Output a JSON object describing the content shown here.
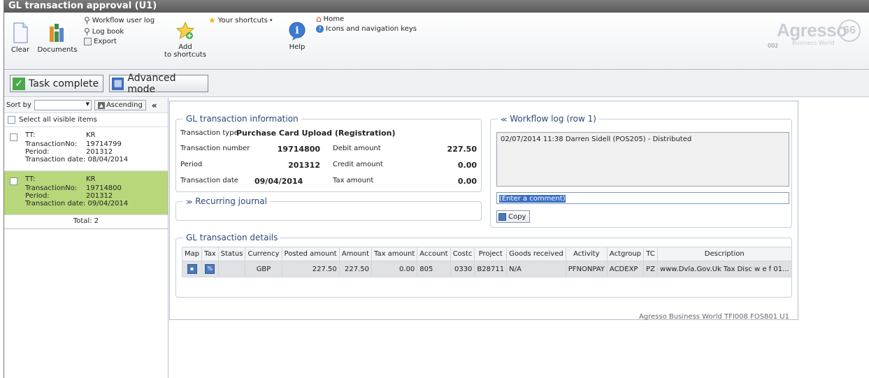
{
  "window": {
    "title": "GL transaction approval (U1)"
  },
  "ribbon": {
    "clear": "Clear",
    "documents": "Documents",
    "workflow_log": "Workflow user log",
    "log_book": "Log book",
    "export": "Export",
    "add_shortcuts_line1": "Add",
    "add_shortcuts_line2": "to shortcuts",
    "your_shortcuts": "Your shortcuts",
    "help": "Help",
    "home": "Home",
    "icons_nav": "Icons and navigation keys",
    "logo_word": "Agresso",
    "logo_sub": "Business World",
    "logo_code": "002",
    "logo_badge": "66"
  },
  "actions": {
    "task_complete": "Task complete",
    "advanced_mode": "Advanced mode"
  },
  "list": {
    "sort_by": "Sort by",
    "ascending": "Ascending",
    "select_all": "Select all visible items",
    "labels": {
      "tt": "TT:",
      "trans_no": "TransactionNo:",
      "period": "Period:",
      "trans_date": "Transaction date:"
    },
    "items": [
      {
        "tt": "KR",
        "trans_no": "19714799",
        "period": "201312",
        "trans_date": "08/04/2014",
        "selected": false
      },
      {
        "tt": "KR",
        "trans_no": "19714800",
        "period": "201312",
        "trans_date": "09/04/2014",
        "selected": true
      }
    ],
    "total": "Total: 2"
  },
  "info": {
    "title": "GL transaction information",
    "transaction_type_label": "Transaction type",
    "transaction_type": "Purchase Card Upload (Registration)",
    "transaction_number_label": "Transaction number",
    "transaction_number": "19714800",
    "debit_label": "Debit amount",
    "debit": "227.50",
    "period_label": "Period",
    "period": "201312",
    "credit_label": "Credit amount",
    "credit": "0.00",
    "date_label": "Transaction date",
    "date": "09/04/2014",
    "tax_label": "Tax amount",
    "tax": "0.00"
  },
  "recurring": {
    "title": "Recurring journal"
  },
  "workflow": {
    "title": "Workflow log (row 1)",
    "entry": "02/07/2014 11:38 Darren Sidell (POS205) - Distributed",
    "comment_placeholder": "(Enter a comment)",
    "copy": "Copy"
  },
  "details": {
    "title": "GL transaction details",
    "columns": [
      "Map",
      "Tax",
      "Status",
      "Currency",
      "Posted amount",
      "Amount",
      "Tax amount",
      "Account",
      "Costc",
      "Project",
      "Goods received",
      "Activity",
      "Actgroup",
      "TC",
      "Description"
    ],
    "rows": [
      {
        "status": "",
        "currency": "GBP",
        "posted_amount": "227.50",
        "amount": "227.50",
        "tax_amount": "0.00",
        "account": "805",
        "costc": "0330",
        "project": "B28711",
        "goods_received": "N/A",
        "activity": "PFNONPAY",
        "actgroup": "ACDEXP",
        "tc": "PZ",
        "description": "www.Dvla.Gov.Uk Tax Disc w e f 01..."
      }
    ]
  },
  "footer": {
    "text": "Agresso Business World  TFI008  FOS801  U1"
  }
}
